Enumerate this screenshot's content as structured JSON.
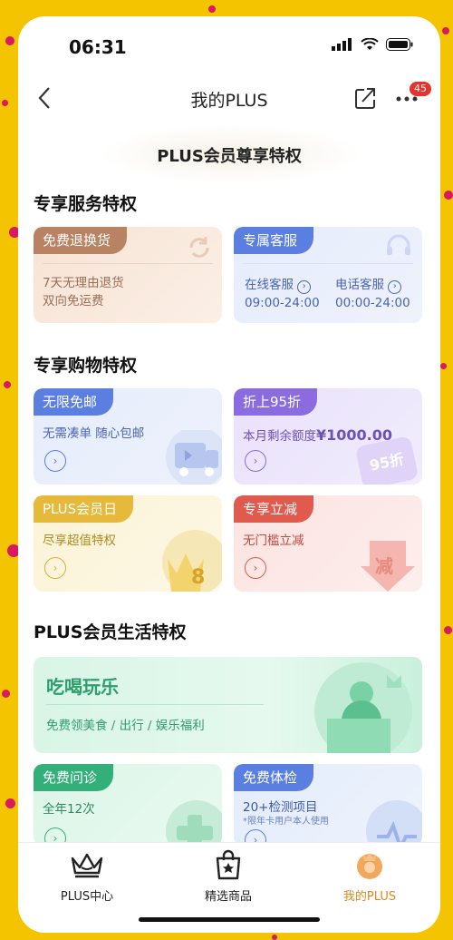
{
  "status": {
    "time": "06:31"
  },
  "nav": {
    "title": "我的PLUS",
    "badge": "45"
  },
  "hero": {
    "title": "PLUS会员尊享特权"
  },
  "sections": {
    "service": "专享服务特权",
    "shopping": "专享购物特权",
    "life": "PLUS会员生活特权"
  },
  "cards": {
    "return": {
      "tag": "免费退换货",
      "line1": "7天无理由退货",
      "line2": "双向免运费"
    },
    "support": {
      "tag": "专属客服",
      "online_label": "在线客服",
      "online_hours": "09:00-24:00",
      "phone_label": "电话客服",
      "phone_hours": "00:00-24:00"
    },
    "shipping": {
      "tag": "无限免邮",
      "desc": "无需凑单 随心包邮"
    },
    "discount": {
      "tag": "折上95折",
      "desc_prefix": "本月剩余额度",
      "amount": "¥1000.00",
      "stamp": "95折"
    },
    "memberday": {
      "tag": "PLUS会员日",
      "desc": "尽享超值特权",
      "crown_number": "8"
    },
    "instant": {
      "tag": "专享立减",
      "desc": "无门槛立减",
      "deco_char": "减"
    },
    "food": {
      "title": "吃喝玩乐",
      "desc": "免费领美食 / 出行 / 娱乐福利"
    },
    "consult": {
      "tag": "免费问诊",
      "desc": "全年12次"
    },
    "checkup": {
      "tag": "免费体检",
      "desc": "20+检测项目",
      "note": "*限年卡用户本人使用"
    }
  },
  "tabs": [
    {
      "label": "PLUS中心"
    },
    {
      "label": "精选商品"
    },
    {
      "label": "我的PLUS"
    }
  ],
  "colors": {
    "accent": "#e08a1e",
    "brand_blue": "#5b7fe0",
    "brand_green": "#33b07a"
  }
}
